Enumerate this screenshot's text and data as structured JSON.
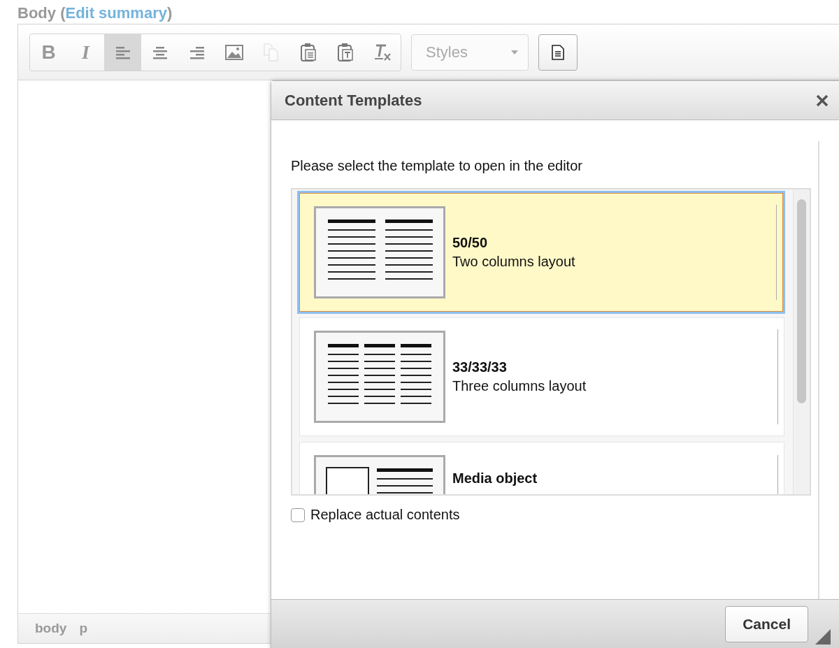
{
  "field": {
    "label": "Body",
    "open_paren": "(",
    "link": "Edit summary",
    "close_paren": ")"
  },
  "toolbar": {
    "buttons": [
      {
        "kind": "bold",
        "label": "B",
        "selected": false,
        "disabled": false
      },
      {
        "kind": "italic",
        "label": "I",
        "selected": false,
        "disabled": false
      },
      {
        "kind": "align-left",
        "selected": true,
        "disabled": false
      },
      {
        "kind": "align-center",
        "selected": false,
        "disabled": false
      },
      {
        "kind": "align-right",
        "selected": false,
        "disabled": false
      },
      {
        "kind": "image",
        "selected": false,
        "disabled": false
      },
      {
        "kind": "copy",
        "selected": false,
        "disabled": true
      },
      {
        "kind": "paste",
        "selected": false,
        "disabled": false
      },
      {
        "kind": "paste-text",
        "selected": false,
        "disabled": false
      },
      {
        "kind": "remove-format",
        "selected": false,
        "disabled": false
      }
    ],
    "styles_placeholder": "Styles"
  },
  "status_bar": {
    "path": [
      "body",
      "p"
    ]
  },
  "dialog": {
    "title": "Content Templates",
    "instruction": "Please select the template to open in the editor",
    "templates": [
      {
        "kind": "two-columns",
        "title": "50/50",
        "description": "Two columns layout",
        "selected": true
      },
      {
        "kind": "three-columns",
        "title": "33/33/33",
        "description": "Three columns layout",
        "selected": false
      },
      {
        "kind": "media",
        "title": "Media object",
        "selected": false
      }
    ],
    "replace": {
      "label": "Replace actual contents",
      "checked": false
    },
    "buttons": [
      "Cancel"
    ]
  }
}
